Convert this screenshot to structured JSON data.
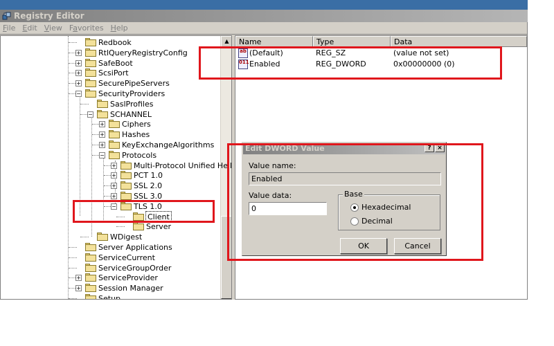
{
  "window": {
    "title": "Registry Editor",
    "menu": [
      "File",
      "Edit",
      "View",
      "Favorites",
      "Help"
    ],
    "menu_mnemonics": [
      "F",
      "E",
      "V",
      "a",
      "H"
    ]
  },
  "tree": {
    "items": [
      {
        "label": "Redbook",
        "level": 0,
        "expander": ""
      },
      {
        "label": "RtlQueryRegistryConfig",
        "level": 0,
        "expander": "+"
      },
      {
        "label": "SafeBoot",
        "level": 0,
        "expander": "+"
      },
      {
        "label": "ScsiPort",
        "level": 0,
        "expander": "+"
      },
      {
        "label": "SecurePipeServers",
        "level": 0,
        "expander": "+"
      },
      {
        "label": "SecurityProviders",
        "level": 0,
        "expander": "−"
      },
      {
        "label": "SaslProfiles",
        "level": 1,
        "expander": ""
      },
      {
        "label": "SCHANNEL",
        "level": 1,
        "expander": "−"
      },
      {
        "label": "Ciphers",
        "level": 2,
        "expander": "+"
      },
      {
        "label": "Hashes",
        "level": 2,
        "expander": "+"
      },
      {
        "label": "KeyExchangeAlgorithms",
        "level": 2,
        "expander": "+"
      },
      {
        "label": "Protocols",
        "level": 2,
        "expander": "−"
      },
      {
        "label": "Multi-Protocol Unified Hello",
        "level": 3,
        "expander": "+"
      },
      {
        "label": "PCT 1.0",
        "level": 3,
        "expander": "+"
      },
      {
        "label": "SSL 2.0",
        "level": 3,
        "expander": "+"
      },
      {
        "label": "SSL 3.0",
        "level": 3,
        "expander": "+"
      },
      {
        "label": "TLS 1.0",
        "level": 3,
        "expander": "−"
      },
      {
        "label": "Client",
        "level": 4,
        "expander": "",
        "selected": true
      },
      {
        "label": "Server",
        "level": 4,
        "expander": ""
      },
      {
        "label": "WDigest",
        "level": 1,
        "expander": ""
      },
      {
        "label": "Server Applications",
        "level": 0,
        "expander": ""
      },
      {
        "label": "ServiceCurrent",
        "level": 0,
        "expander": ""
      },
      {
        "label": "ServiceGroupOrder",
        "level": 0,
        "expander": ""
      },
      {
        "label": "ServiceProvider",
        "level": 0,
        "expander": "+"
      },
      {
        "label": "Session Manager",
        "level": 0,
        "expander": "+"
      },
      {
        "label": "Setup",
        "level": 0,
        "expander": ""
      }
    ]
  },
  "values": {
    "columns": [
      "Name",
      "Type",
      "Data"
    ],
    "rows": [
      {
        "name": "(Default)",
        "type": "REG_SZ",
        "data": "(value not set)",
        "icon": "string-value-icon",
        "glyph": "ab"
      },
      {
        "name": "Enabled",
        "type": "REG_DWORD",
        "data": "0x00000000 (0)",
        "icon": "binary-value-icon",
        "glyph": "011"
      }
    ]
  },
  "dialog": {
    "title": "Edit DWORD Value",
    "value_name_label": "Value name:",
    "value_name": "Enabled",
    "value_data_label": "Value data:",
    "value_data": "0",
    "base_label": "Base",
    "radio_hex": "Hexadecimal",
    "radio_dec": "Decimal",
    "selected_base": "Hexadecimal",
    "ok": "OK",
    "cancel": "Cancel",
    "help_glyph": "?",
    "close_glyph": "×"
  },
  "colors": {
    "highlight_box": "#e0161c",
    "desktop_blue": "#3a6ea5",
    "face": "#d4d0c8"
  }
}
